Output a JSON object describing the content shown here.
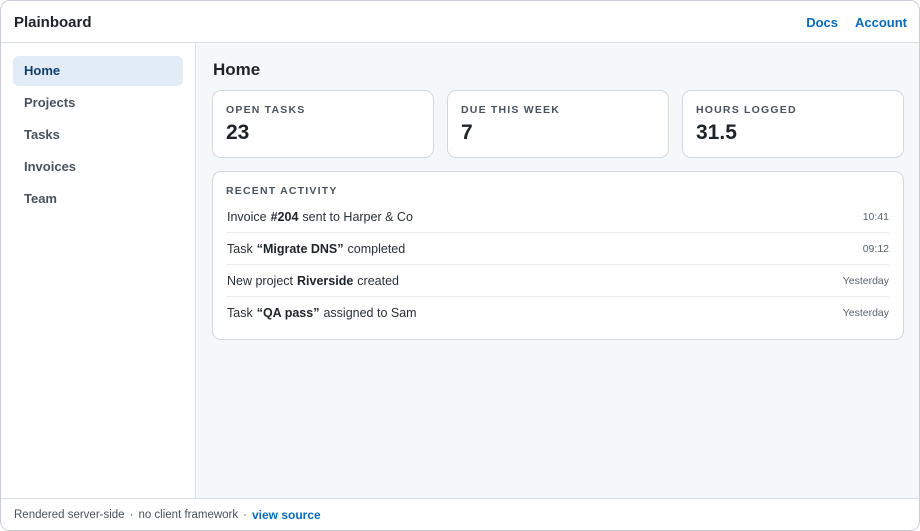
{
  "app": {
    "brand": "Plainboard"
  },
  "topnav": {
    "docs": "Docs",
    "account": "Account"
  },
  "sidebar": {
    "items": [
      {
        "label": "Home",
        "active": true
      },
      {
        "label": "Projects"
      },
      {
        "label": "Tasks"
      },
      {
        "label": "Invoices"
      },
      {
        "label": "Team"
      }
    ]
  },
  "main": {
    "title": "Home",
    "stats": [
      {
        "label": "OPEN TASKS",
        "value": "23"
      },
      {
        "label": "DUE THIS WEEK",
        "value": "7"
      },
      {
        "label": "HOURS LOGGED",
        "value": "31.5"
      }
    ],
    "activity": {
      "heading": "RECENT ACTIVITY",
      "rows": [
        {
          "pre": "Invoice",
          "strong": "#204",
          "post": "sent to Harper & Co",
          "time": "10:41"
        },
        {
          "pre": "Task",
          "strong": "“Migrate DNS”",
          "post": "completed",
          "time": "09:12"
        },
        {
          "pre": "New project",
          "strong": "Riverside",
          "post": "created",
          "time": "Yesterday"
        },
        {
          "pre": "Task",
          "strong": "“QA pass”",
          "post": "assigned to Sam",
          "time": "Yesterday"
        }
      ]
    }
  },
  "footer": {
    "text1": "Rendered server-side",
    "sep": "·",
    "text2": "no client framework",
    "link": "view source"
  },
  "colors": {
    "accent": "#0b6ab8",
    "active_bg": "#e2ecf6",
    "main_bg": "#f6f7f9"
  }
}
